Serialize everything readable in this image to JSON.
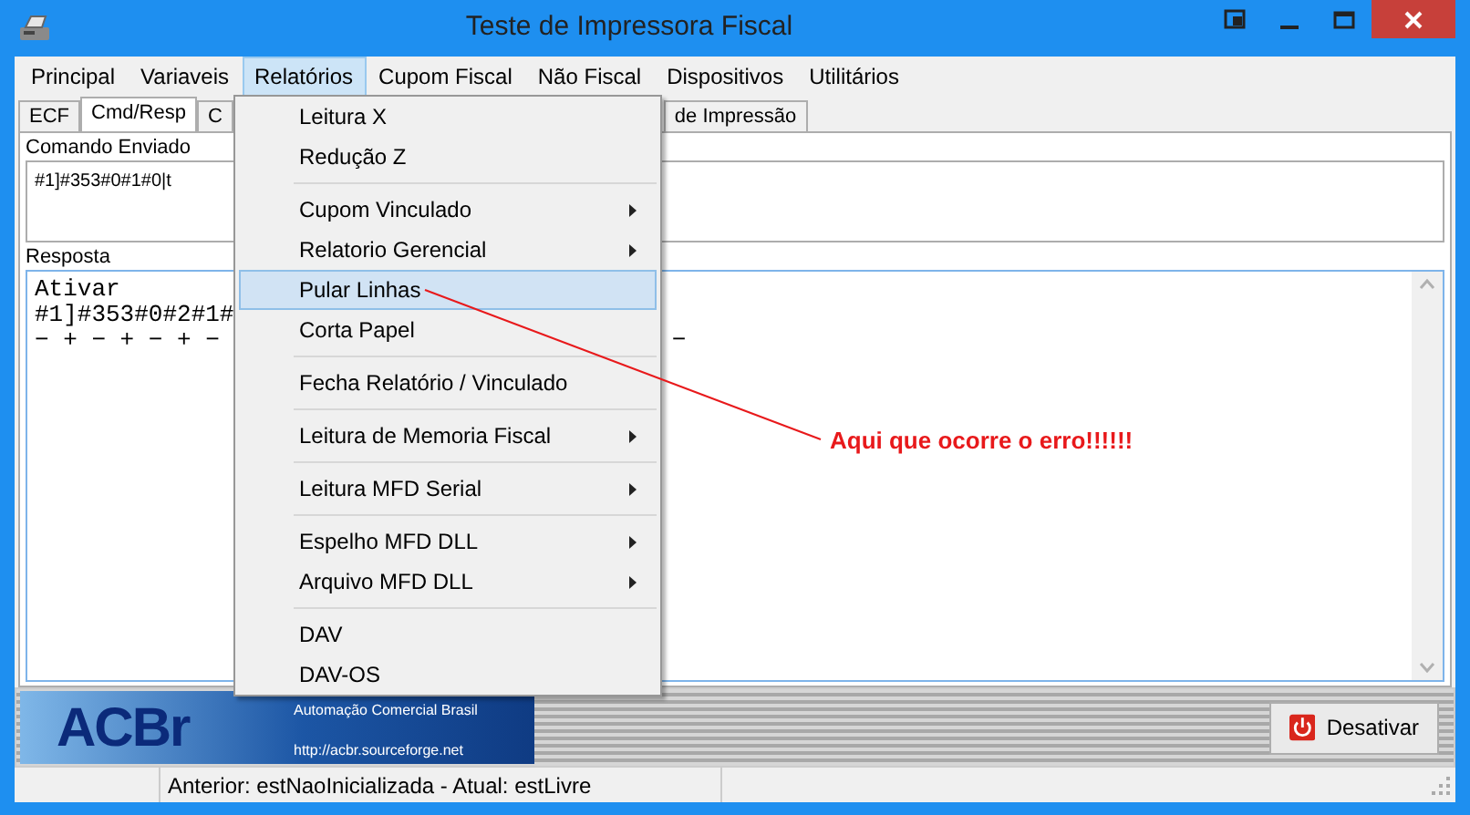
{
  "window": {
    "title": "Teste de Impressora Fiscal"
  },
  "menu_bar": [
    {
      "label": "Principal",
      "selected": false
    },
    {
      "label": "Variaveis",
      "selected": false
    },
    {
      "label": "Relatórios",
      "selected": true
    },
    {
      "label": "Cupom Fiscal",
      "selected": false
    },
    {
      "label": "Não Fiscal",
      "selected": false
    },
    {
      "label": "Dispositivos",
      "selected": false
    },
    {
      "label": "Utilitários",
      "selected": false
    }
  ],
  "tabs": [
    {
      "label": "ECF",
      "selected": false
    },
    {
      "label": "Cmd/Resp",
      "selected": true
    },
    {
      "label": "C",
      "selected": false
    },
    {
      "label": "de Impressão",
      "selected": false
    }
  ],
  "command_sent": {
    "label": "Comando Enviado",
    "value": "#1]#353#0#1#0|t"
  },
  "response": {
    "label": "Resposta",
    "lines": [
      "Ativar",
      "#1]#353#0#2#1#",
      "− + − + − + −"
    ],
    "trailing_fragment": "−"
  },
  "dropdown_menu": [
    {
      "kind": "item",
      "label": "Leitura X",
      "submenu": false,
      "selected": false
    },
    {
      "kind": "item",
      "label": "Redução Z",
      "submenu": false,
      "selected": false
    },
    {
      "kind": "separator"
    },
    {
      "kind": "item",
      "label": "Cupom Vinculado",
      "submenu": true,
      "selected": false
    },
    {
      "kind": "item",
      "label": "Relatorio Gerencial",
      "submenu": true,
      "selected": false
    },
    {
      "kind": "item",
      "label": "Pular Linhas",
      "submenu": false,
      "selected": true
    },
    {
      "kind": "item",
      "label": "Corta Papel",
      "submenu": false,
      "selected": false
    },
    {
      "kind": "separator"
    },
    {
      "kind": "item",
      "label": "Fecha Relatório / Vinculado",
      "submenu": false,
      "selected": false
    },
    {
      "kind": "separator"
    },
    {
      "kind": "item",
      "label": "Leitura de Memoria Fiscal",
      "submenu": true,
      "selected": false
    },
    {
      "kind": "separator"
    },
    {
      "kind": "item",
      "label": "Leitura MFD Serial",
      "submenu": true,
      "selected": false
    },
    {
      "kind": "separator"
    },
    {
      "kind": "item",
      "label": "Espelho MFD DLL",
      "submenu": true,
      "selected": false
    },
    {
      "kind": "item",
      "label": "Arquivo MFD DLL",
      "submenu": true,
      "selected": false
    },
    {
      "kind": "separator"
    },
    {
      "kind": "item",
      "label": "DAV",
      "submenu": false,
      "selected": false
    },
    {
      "kind": "item",
      "label": "DAV-OS",
      "submenu": false,
      "selected": false
    }
  ],
  "annotation": {
    "text": "Aqui que ocorre o erro!!!!!!"
  },
  "banner": {
    "logo": "ACBr",
    "tagline": "Automação Comercial Brasil",
    "url": "http://acbr.sourceforge.net"
  },
  "deactivate_button": {
    "label": "Desativar"
  },
  "status_bar": [
    "Anterior: estNaoInicializada - Atual: estLivre"
  ]
}
